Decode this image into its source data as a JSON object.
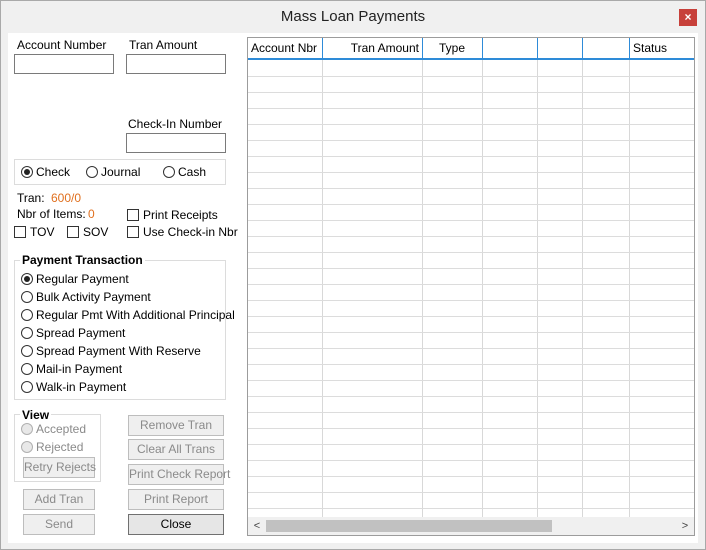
{
  "window": {
    "title": "Mass Loan Payments",
    "close_glyph": "×"
  },
  "fields": {
    "account_number_label": "Account Number",
    "tran_amount_label": "Tran Amount",
    "checkin_number_label": "Check-In Number",
    "account_number_value": "",
    "tran_amount_value": "",
    "checkin_number_value": ""
  },
  "payment_method": {
    "options": [
      "Check",
      "Journal",
      "Cash"
    ],
    "selected": "Check"
  },
  "tran": {
    "label": "Tran:",
    "value": "600/0"
  },
  "items": {
    "label": "Nbr of Items:",
    "value": "0"
  },
  "checkboxes": {
    "print_receipts": "Print Receipts",
    "tov": "TOV",
    "sov": "SOV",
    "use_checkin": "Use Check-in Nbr"
  },
  "payment_transaction": {
    "title": "Payment Transaction",
    "options": [
      "Regular Payment",
      "Bulk Activity Payment",
      "Regular Pmt With Additional Principal",
      "Spread Payment",
      "Spread Payment With Reserve",
      "Mail-in Payment",
      "Walk-in Payment"
    ],
    "selected": "Regular Payment"
  },
  "view": {
    "title": "View",
    "accepted": "Accepted",
    "rejected": "Rejected",
    "retry": "Retry Rejects"
  },
  "buttons": {
    "remove_tran": "Remove Tran",
    "clear_all": "Clear All Trans",
    "print_check": "Print Check Report",
    "print_report": "Print Report",
    "add_tran": "Add Tran",
    "send": "Send",
    "close": "Close"
  },
  "grid": {
    "columns": [
      "Account Nbr",
      "Tran Amount",
      "Type",
      "",
      "",
      "",
      "Status"
    ],
    "rows": []
  },
  "scrollbar": {
    "left_glyph": "<",
    "right_glyph": ">"
  },
  "colors": {
    "accent": "#2e8bd8",
    "value_orange": "#e0701f",
    "close_red": "#c7403a"
  }
}
